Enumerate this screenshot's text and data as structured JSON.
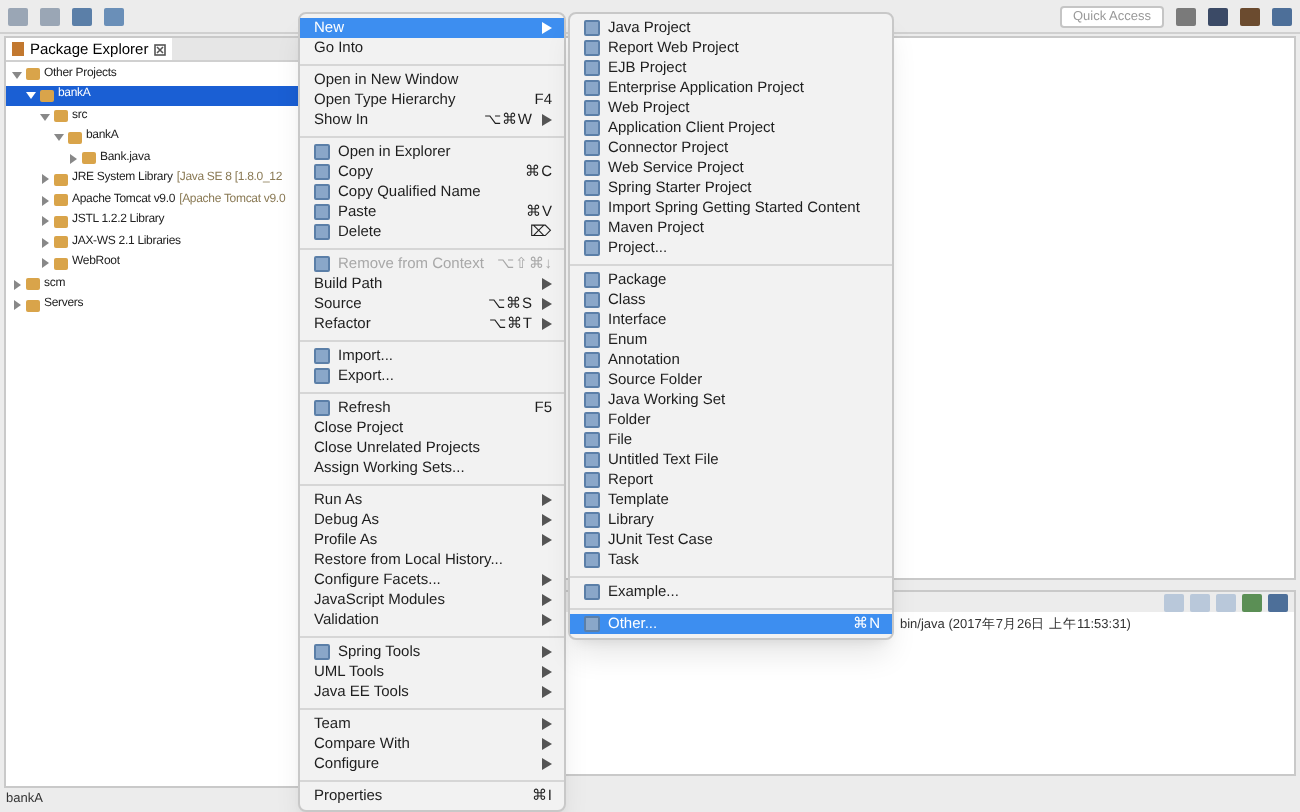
{
  "toolbar": {
    "quick_access": {
      "placeholder": "Quick Access"
    }
  },
  "package_explorer": {
    "tab": {
      "label": "Package Explorer",
      "selected": true
    },
    "tree": [
      {
        "label": "Other Projects",
        "expanded": true,
        "selected": false,
        "children": [
          {
            "label": "bankA",
            "expanded": true,
            "selected": true,
            "children": [
              {
                "label": "src",
                "expanded": true,
                "selected": false,
                "children": [
                  {
                    "label": "bankA",
                    "expanded": true,
                    "selected": false,
                    "children": [
                      {
                        "label": "Bank.java",
                        "expanded": false,
                        "selected": false
                      }
                    ]
                  }
                ]
              },
              {
                "label": "JRE System Library",
                "detail": "[Java SE 8 [1.8.0_12",
                "expanded": false,
                "selected": false
              },
              {
                "label": "Apache Tomcat v9.0",
                "detail": "[Apache Tomcat v9.0",
                "expanded": false,
                "selected": false
              },
              {
                "label": "JSTL 1.2.2 Library",
                "expanded": false,
                "selected": false
              },
              {
                "label": "JAX-WS 2.1 Libraries",
                "expanded": false,
                "selected": false
              },
              {
                "label": "WebRoot",
                "expanded": false,
                "selected": false
              }
            ]
          }
        ]
      },
      {
        "label": "scm",
        "expanded": false,
        "selected": false
      },
      {
        "label": "Servers",
        "expanded": false,
        "selected": false
      }
    ]
  },
  "console": {
    "text": "bin/java (2017年7月26日 上午11:53:31)"
  },
  "status_bar": {
    "text": "bankA"
  },
  "context_menu": [
    {
      "kind": "item",
      "label": "New",
      "submenu": true,
      "selected": true,
      "disabled": false
    },
    {
      "kind": "item",
      "label": "Go Into",
      "selected": false,
      "disabled": false
    },
    {
      "kind": "separator"
    },
    {
      "kind": "item",
      "label": "Open in New Window",
      "selected": false,
      "disabled": false
    },
    {
      "kind": "item",
      "label": "Open Type Hierarchy",
      "shortcut": "F4",
      "selected": false,
      "disabled": false
    },
    {
      "kind": "item",
      "label": "Show In",
      "shortcut": "⌥⌘W",
      "submenu": true,
      "selected": false,
      "disabled": false
    },
    {
      "kind": "separator"
    },
    {
      "kind": "item",
      "label": "Open in Explorer",
      "icon": true,
      "selected": false,
      "disabled": false
    },
    {
      "kind": "item",
      "label": "Copy",
      "shortcut": "⌘C",
      "icon": true,
      "selected": false,
      "disabled": false
    },
    {
      "kind": "item",
      "label": "Copy Qualified Name",
      "icon": true,
      "selected": false,
      "disabled": false
    },
    {
      "kind": "item",
      "label": "Paste",
      "shortcut": "⌘V",
      "icon": true,
      "selected": false,
      "disabled": false
    },
    {
      "kind": "item",
      "label": "Delete",
      "shortcut": "⌦",
      "icon": true,
      "selected": false,
      "disabled": false
    },
    {
      "kind": "separator"
    },
    {
      "kind": "item",
      "label": "Remove from Context",
      "shortcut": "⌥⇧⌘↓",
      "icon": true,
      "selected": false,
      "disabled": true
    },
    {
      "kind": "item",
      "label": "Build Path",
      "submenu": true,
      "selected": false,
      "disabled": false
    },
    {
      "kind": "item",
      "label": "Source",
      "shortcut": "⌥⌘S",
      "submenu": true,
      "selected": false,
      "disabled": false
    },
    {
      "kind": "item",
      "label": "Refactor",
      "shortcut": "⌥⌘T",
      "submenu": true,
      "selected": false,
      "disabled": false
    },
    {
      "kind": "separator"
    },
    {
      "kind": "item",
      "label": "Import...",
      "icon": true,
      "selected": false,
      "disabled": false
    },
    {
      "kind": "item",
      "label": "Export...",
      "icon": true,
      "selected": false,
      "disabled": false
    },
    {
      "kind": "separator"
    },
    {
      "kind": "item",
      "label": "Refresh",
      "shortcut": "F5",
      "icon": true,
      "selected": false,
      "disabled": false
    },
    {
      "kind": "item",
      "label": "Close Project",
      "selected": false,
      "disabled": false
    },
    {
      "kind": "item",
      "label": "Close Unrelated Projects",
      "selected": false,
      "disabled": false
    },
    {
      "kind": "item",
      "label": "Assign Working Sets...",
      "selected": false,
      "disabled": false
    },
    {
      "kind": "separator"
    },
    {
      "kind": "item",
      "label": "Run As",
      "submenu": true,
      "selected": false,
      "disabled": false
    },
    {
      "kind": "item",
      "label": "Debug As",
      "submenu": true,
      "selected": false,
      "disabled": false
    },
    {
      "kind": "item",
      "label": "Profile As",
      "submenu": true,
      "selected": false,
      "disabled": false
    },
    {
      "kind": "item",
      "label": "Restore from Local History...",
      "selected": false,
      "disabled": false
    },
    {
      "kind": "item",
      "label": "Configure Facets...",
      "submenu": true,
      "selected": false,
      "disabled": false
    },
    {
      "kind": "item",
      "label": "JavaScript Modules",
      "submenu": true,
      "selected": false,
      "disabled": false
    },
    {
      "kind": "item",
      "label": "Validation",
      "submenu": true,
      "selected": false,
      "disabled": false
    },
    {
      "kind": "separator"
    },
    {
      "kind": "item",
      "label": "Spring Tools",
      "icon": true,
      "submenu": true,
      "selected": false,
      "disabled": false
    },
    {
      "kind": "item",
      "label": "UML Tools",
      "submenu": true,
      "selected": false,
      "disabled": false
    },
    {
      "kind": "item",
      "label": "Java EE Tools",
      "submenu": true,
      "selected": false,
      "disabled": false
    },
    {
      "kind": "separator"
    },
    {
      "kind": "item",
      "label": "Team",
      "submenu": true,
      "selected": false,
      "disabled": false
    },
    {
      "kind": "item",
      "label": "Compare With",
      "submenu": true,
      "selected": false,
      "disabled": false
    },
    {
      "kind": "item",
      "label": "Configure",
      "submenu": true,
      "selected": false,
      "disabled": false
    },
    {
      "kind": "separator"
    },
    {
      "kind": "item",
      "label": "Properties",
      "shortcut": "⌘I",
      "selected": false,
      "disabled": false
    }
  ],
  "new_submenu": [
    {
      "kind": "item",
      "label": "Java Project",
      "icon": true,
      "selected": false
    },
    {
      "kind": "item",
      "label": "Report Web Project",
      "icon": true,
      "selected": false
    },
    {
      "kind": "item",
      "label": "EJB Project",
      "icon": true,
      "selected": false
    },
    {
      "kind": "item",
      "label": "Enterprise Application Project",
      "icon": true,
      "selected": false
    },
    {
      "kind": "item",
      "label": "Web Project",
      "icon": true,
      "selected": false
    },
    {
      "kind": "item",
      "label": "Application Client Project",
      "icon": true,
      "selected": false
    },
    {
      "kind": "item",
      "label": "Connector Project",
      "icon": true,
      "selected": false
    },
    {
      "kind": "item",
      "label": "Web Service Project",
      "icon": true,
      "selected": false
    },
    {
      "kind": "item",
      "label": "Spring Starter Project",
      "icon": true,
      "selected": false
    },
    {
      "kind": "item",
      "label": "Import Spring Getting Started Content",
      "icon": true,
      "selected": false
    },
    {
      "kind": "item",
      "label": "Maven Project",
      "icon": true,
      "selected": false
    },
    {
      "kind": "item",
      "label": "Project...",
      "icon": true,
      "selected": false
    },
    {
      "kind": "separator"
    },
    {
      "kind": "item",
      "label": "Package",
      "icon": true,
      "selected": false
    },
    {
      "kind": "item",
      "label": "Class",
      "icon": true,
      "selected": false
    },
    {
      "kind": "item",
      "label": "Interface",
      "icon": true,
      "selected": false
    },
    {
      "kind": "item",
      "label": "Enum",
      "icon": true,
      "selected": false
    },
    {
      "kind": "item",
      "label": "Annotation",
      "icon": true,
      "selected": false
    },
    {
      "kind": "item",
      "label": "Source Folder",
      "icon": true,
      "selected": false
    },
    {
      "kind": "item",
      "label": "Java Working Set",
      "icon": true,
      "selected": false
    },
    {
      "kind": "item",
      "label": "Folder",
      "icon": true,
      "selected": false
    },
    {
      "kind": "item",
      "label": "File",
      "icon": true,
      "selected": false
    },
    {
      "kind": "item",
      "label": "Untitled Text File",
      "icon": true,
      "selected": false
    },
    {
      "kind": "item",
      "label": "Report",
      "icon": true,
      "selected": false
    },
    {
      "kind": "item",
      "label": "Template",
      "icon": true,
      "selected": false
    },
    {
      "kind": "item",
      "label": "Library",
      "icon": true,
      "selected": false
    },
    {
      "kind": "item",
      "label": "JUnit Test Case",
      "icon": true,
      "selected": false
    },
    {
      "kind": "item",
      "label": "Task",
      "icon": true,
      "selected": false
    },
    {
      "kind": "separator"
    },
    {
      "kind": "item",
      "label": "Example...",
      "icon": true,
      "selected": false
    },
    {
      "kind": "separator"
    },
    {
      "kind": "item",
      "label": "Other...",
      "shortcut": "⌘N",
      "icon": true,
      "selected": true
    }
  ]
}
